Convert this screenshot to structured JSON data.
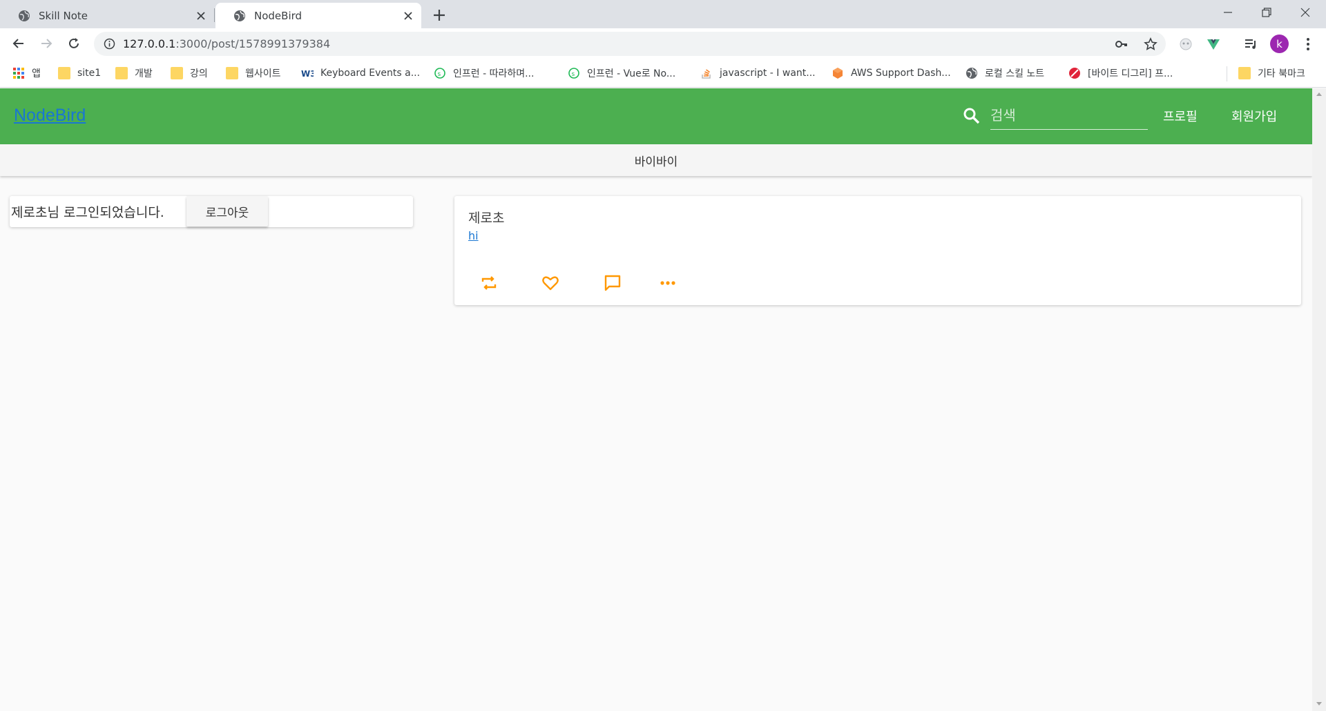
{
  "browser": {
    "tabs": [
      {
        "title": "Skill Note",
        "active": false
      },
      {
        "title": "NodeBird",
        "active": true
      }
    ],
    "url_host": "127.0.0.1",
    "url_path": ":3000/post/1578991379384",
    "avatar_initial": "k",
    "bookmarks": [
      {
        "label": "앱",
        "icon": "apps-grid-icon"
      },
      {
        "label": "site1",
        "icon": "folder-icon"
      },
      {
        "label": "개발",
        "icon": "folder-icon"
      },
      {
        "label": "강의",
        "icon": "folder-icon"
      },
      {
        "label": "웹사이트",
        "icon": "folder-icon"
      },
      {
        "label": "Keyboard Events a...",
        "icon": "w3-icon"
      },
      {
        "label": "인프런 - 따라하며...",
        "icon": "inflearn-icon"
      },
      {
        "label": "인프런 - Vue로 No...",
        "icon": "inflearn-icon"
      },
      {
        "label": "javascript - I want...",
        "icon": "stackoverflow-icon"
      },
      {
        "label": "AWS Support Dash...",
        "icon": "aws-icon"
      },
      {
        "label": "로컬 스킬 노트",
        "icon": "globe-icon"
      },
      {
        "label": "[바이트 디그리] 프...",
        "icon": "byte-icon"
      },
      {
        "label": "기타 북마크",
        "icon": "folder-icon"
      }
    ]
  },
  "app": {
    "brand": "NodeBird",
    "search_placeholder": "검색",
    "nav": {
      "profile": "프로필",
      "signup": "회원가입"
    },
    "subbar_text": "바이바이",
    "login": {
      "message": "제로초님 로그인되었습니다.",
      "logout_label": "로그아웃"
    },
    "post": {
      "author": "제로초",
      "content": "hi"
    },
    "colors": {
      "appbar": "#4caf50",
      "action_icons": "#ff9800",
      "link": "#1976d2"
    }
  }
}
